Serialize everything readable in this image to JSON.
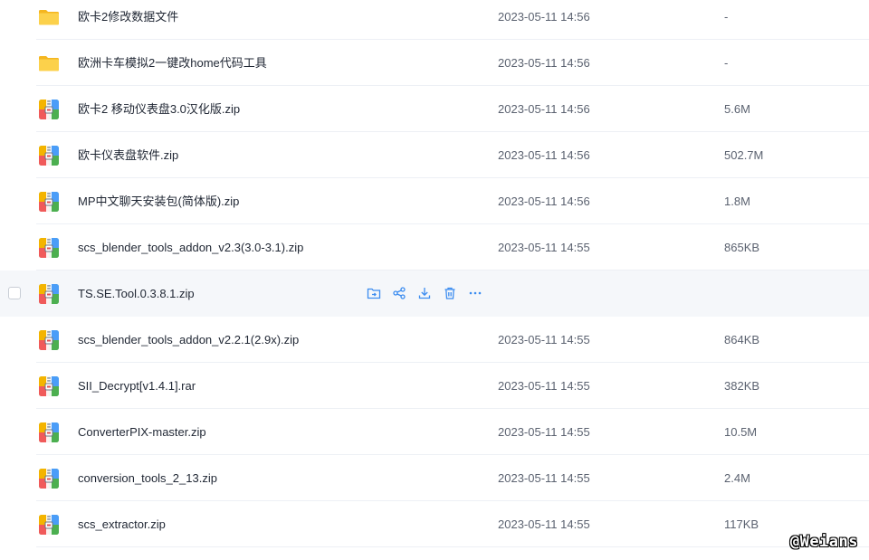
{
  "files": [
    {
      "name": "欧卡2修改数据文件",
      "type": "folder",
      "date": "2023-05-11 14:56",
      "size": "-"
    },
    {
      "name": "欧洲卡车模拟2一键改home代码工具",
      "type": "folder",
      "date": "2023-05-11 14:56",
      "size": "-"
    },
    {
      "name": "欧卡2 移动仪表盘3.0汉化版.zip",
      "type": "archive",
      "date": "2023-05-11 14:56",
      "size": "5.6M"
    },
    {
      "name": "欧卡仪表盘软件.zip",
      "type": "archive",
      "date": "2023-05-11 14:56",
      "size": "502.7M"
    },
    {
      "name": "MP中文聊天安装包(简体版).zip",
      "type": "archive",
      "date": "2023-05-11 14:56",
      "size": "1.8M"
    },
    {
      "name": "scs_blender_tools_addon_v2.3(3.0-3.1).zip",
      "type": "archive",
      "date": "2023-05-11 14:55",
      "size": "865KB"
    },
    {
      "name": "TS.SE.Tool.0.3.8.1.zip",
      "type": "archive",
      "date": "",
      "size": "",
      "hovered": true
    },
    {
      "name": "scs_blender_tools_addon_v2.2.1(2.9x).zip",
      "type": "archive",
      "date": "2023-05-11 14:55",
      "size": "864KB"
    },
    {
      "name": "SII_Decrypt[v1.4.1].rar",
      "type": "archive",
      "date": "2023-05-11 14:55",
      "size": "382KB"
    },
    {
      "name": "ConverterPIX-master.zip",
      "type": "archive",
      "date": "2023-05-11 14:55",
      "size": "10.5M"
    },
    {
      "name": "conversion_tools_2_13.zip",
      "type": "archive",
      "date": "2023-05-11 14:55",
      "size": "2.4M"
    },
    {
      "name": "scs_extractor.zip",
      "type": "archive",
      "date": "2023-05-11 14:55",
      "size": "117KB"
    }
  ],
  "row_actions": [
    {
      "icon": "move-to-folder-icon"
    },
    {
      "icon": "share-icon"
    },
    {
      "icon": "download-icon"
    },
    {
      "icon": "delete-icon"
    },
    {
      "icon": "more-icon"
    }
  ],
  "colors": {
    "folder": "#f9c43b",
    "action": "#3b8cf0",
    "hover_bg": "#f5f7fa"
  },
  "watermark": "@Weians"
}
